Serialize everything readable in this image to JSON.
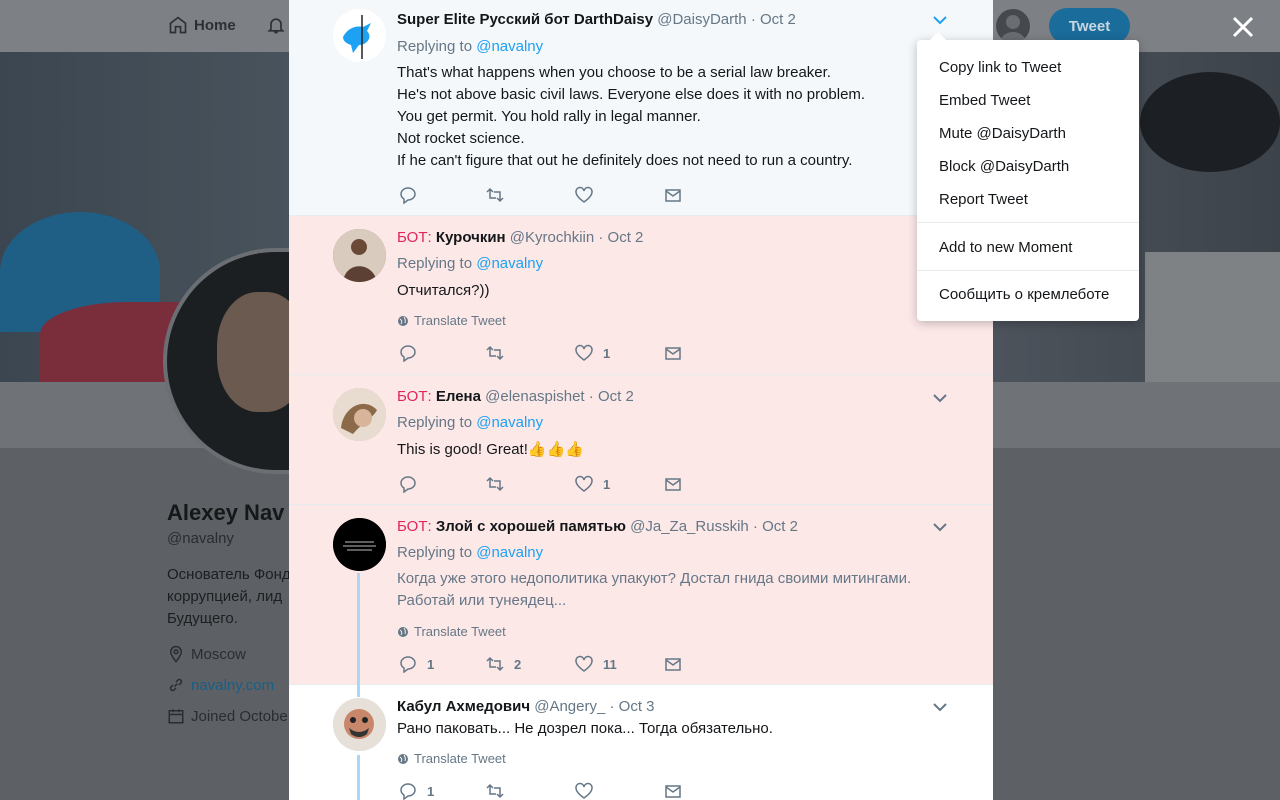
{
  "nav": {
    "home_label": "Home",
    "tweet_button": "Tweet"
  },
  "profile": {
    "name": "Alexey Nav",
    "handle": "@navalny",
    "bio_lines": [
      "Основатель Фонд",
      "коррупцией, лид",
      "Будущего."
    ],
    "location": "Moscow",
    "website": "navalny.com",
    "joined": "Joined Octobe"
  },
  "colors": {
    "bot_label": "#e0245e",
    "link": "#1da1f2",
    "bot_bg": "#fde8e8",
    "thread_line": "#a8d8f5"
  },
  "tweets": [
    {
      "bot_label": "",
      "name": "Super Elite Русский бот DarthDaisy",
      "handle": "@DaisyDarth",
      "dot": "·",
      "date": "Oct 2",
      "replying_prefix": "Replying to",
      "replying_to": "@navalny",
      "text": "That's what happens when you choose to be a serial law breaker.\nHe's not above basic civil laws. Everyone else does it with no problem.\nYou get permit. You hold rally in legal manner.\nNot rocket science.\nIf he can't figure that out he definitely does not need to run a country.",
      "counts": {
        "reply": "",
        "retweet": "",
        "like": ""
      }
    },
    {
      "bot_label": "БОТ:",
      "name": "Курочкин",
      "handle": "@Kyrochkiin",
      "dot": "·",
      "date": "Oct 2",
      "replying_prefix": "Replying to",
      "replying_to": "@navalny",
      "text": "Отчитался?))",
      "translate": "Translate Tweet",
      "counts": {
        "reply": "",
        "retweet": "",
        "like": "1"
      }
    },
    {
      "bot_label": "БОТ:",
      "name": "Елена",
      "handle": "@elenaspishet",
      "dot": "·",
      "date": "Oct 2",
      "replying_prefix": "Replying to",
      "replying_to": "@navalny",
      "text": "This is good! Great!👍👍👍",
      "counts": {
        "reply": "",
        "retweet": "",
        "like": "1"
      }
    },
    {
      "bot_label": "БОТ:",
      "name": "Злой с хорошей памятью",
      "handle": "@Ja_Za_Russkih",
      "dot": "·",
      "date": "Oct 2",
      "replying_prefix": "Replying to",
      "replying_to": "@navalny",
      "text": "Когда уже этого недополитика упакуют? Достал гнида своими митингами.\nРаботай или тунеядец...",
      "translate": "Translate Tweet",
      "counts": {
        "reply": "1",
        "retweet": "2",
        "like": "11"
      }
    },
    {
      "bot_label": "",
      "name": "Кабул Ахмедович",
      "handle": "@Angery_",
      "dot": "·",
      "date": "Oct 3",
      "text": "Рано паковать... Не дозрел пока... Тогда обязательно.",
      "translate": "Translate Tweet",
      "counts": {
        "reply": "1",
        "retweet": "",
        "like": ""
      }
    }
  ],
  "dropdown": {
    "items": [
      "Copy link to Tweet",
      "Embed Tweet",
      "Mute @DaisyDarth",
      "Block @DaisyDarth",
      "Report Tweet"
    ],
    "moment": "Add to new Moment",
    "report_bot": "Сообщить о кремлеботе"
  },
  "icons": {
    "home": "home-icon",
    "bell": "bell-icon",
    "close": "close-icon",
    "reply": "reply-icon",
    "retweet": "retweet-icon",
    "like": "heart-icon",
    "dm": "envelope-icon",
    "chevron": "chevron-down-icon",
    "translate": "globe-icon",
    "location": "location-pin-icon",
    "link": "link-icon",
    "calendar": "calendar-icon"
  }
}
